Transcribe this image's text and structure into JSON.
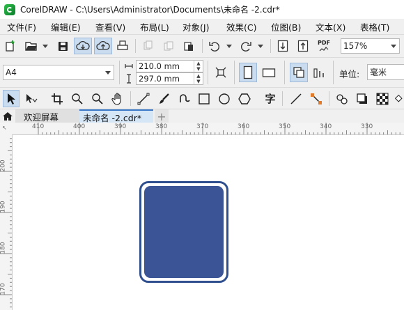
{
  "titlebar": {
    "title": "CorelDRAW - C:\\Users\\Administrator\\Documents\\未命名 -2.cdr*"
  },
  "menu": [
    "文件(F)",
    "编辑(E)",
    "查看(V)",
    "布局(L)",
    "对象(J)",
    "效果(C)",
    "位图(B)",
    "文本(X)",
    "表格(T)"
  ],
  "toolbar": {
    "pdf_label": "PDF",
    "zoom_value": "157%"
  },
  "propertybar": {
    "page_size": "A4",
    "width_value": "210.0 mm",
    "height_value": "297.0 mm",
    "units_label": "单位:",
    "units_value": "毫米"
  },
  "toolbox": {
    "text_tool_glyph": "字"
  },
  "tabs": {
    "welcome": "欢迎屏幕",
    "document": "未命名 -2.cdr*",
    "add": "+"
  },
  "ruler": {
    "horizontal": [
      "410",
      "400",
      "390",
      "380",
      "370",
      "360",
      "350",
      "340",
      "330"
    ],
    "vertical": [
      "200",
      "190",
      "180",
      "170"
    ]
  },
  "shape": {
    "fill_color": "#3a5495",
    "outline_color": "#2f4f8e"
  }
}
